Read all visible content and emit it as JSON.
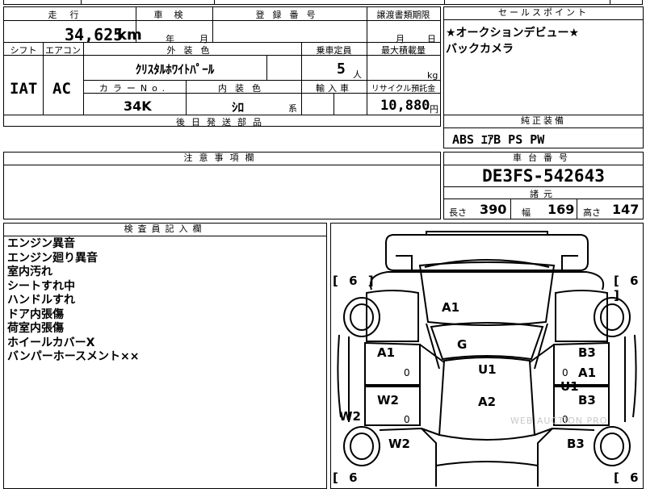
{
  "top_strip": {
    "partial_text": ""
  },
  "mileage": {
    "header": "走行",
    "value": "34,625",
    "unit": "km"
  },
  "inspection": {
    "header": "車検",
    "year_label": "年",
    "month_label": "月"
  },
  "registration": {
    "header": "登録番号",
    "value": ""
  },
  "transfer_deadline": {
    "header": "譲渡書類期限",
    "month_label": "月",
    "day_label": "日"
  },
  "shift": {
    "header": "シフト",
    "value": "IAT"
  },
  "aircon": {
    "header": "エアコン",
    "value": "AC"
  },
  "exterior_color": {
    "header": "外装色",
    "value": "ｸﾘｽﾀﾙﾎﾜｲﾄﾊﾟｰﾙ"
  },
  "capacity": {
    "header": "乗車定員",
    "value": "5",
    "unit": "人"
  },
  "max_load": {
    "header": "最大積載量",
    "unit": "kg"
  },
  "color_no": {
    "header": "カラーNo.",
    "value": "34K"
  },
  "interior_color": {
    "header": "内装色",
    "value": "ｼﾛ",
    "suffix": "系"
  },
  "import": {
    "header": "輸入車"
  },
  "recycle": {
    "header": "リサイクル預託金",
    "value": "10,880",
    "unit": "円"
  },
  "delivery_parts": {
    "header": "後日発送部品"
  },
  "sales_points": {
    "header": "セールスポイント",
    "lines": [
      "★オークションデビュー★",
      "バックカメラ"
    ]
  },
  "standard_equipment": {
    "header": "純正装備",
    "value": "ABS ｴｱB PS PW"
  },
  "caution": {
    "header": "注意事項欄"
  },
  "chassis": {
    "header": "車台番号",
    "value": "DE3FS-542643"
  },
  "dimensions": {
    "header": "諸元",
    "length_label": "長さ",
    "length_value": "390",
    "width_label": "幅",
    "width_value": "169",
    "height_label": "高さ",
    "height_value": "147"
  },
  "inspector_notes": {
    "header": "検査員記入欄",
    "lines": [
      "エンジン異音",
      "エンジン廻り異音",
      "室内汚れ",
      "シートすれ中",
      "ハンドルすれ",
      "ドア内張傷",
      "荷室内張傷",
      "ホイールカバーX",
      "バンパーホースメント××"
    ]
  },
  "diagram": {
    "tire_fl": "[ 6 ]",
    "tire_fr": "[ 6 ]",
    "tire_rl": "[ 6",
    "tire_rr": "[ 6",
    "hood": "A1",
    "windshield": "G",
    "left_front_door": "A1",
    "roof": "U1",
    "right_front_door_a": "B3",
    "right_front_door_b": "A1",
    "right_side_u": "U1",
    "left_rear_door": "W2",
    "center_a": "A2",
    "right_rear_door": "B3",
    "left_rocker": "W2",
    "left_rear_fender": "W2",
    "right_rear_fender": "B3",
    "zero_marks": [
      "0",
      "0",
      "0",
      "0"
    ],
    "watermark": "WEB AUCTION PRO"
  }
}
